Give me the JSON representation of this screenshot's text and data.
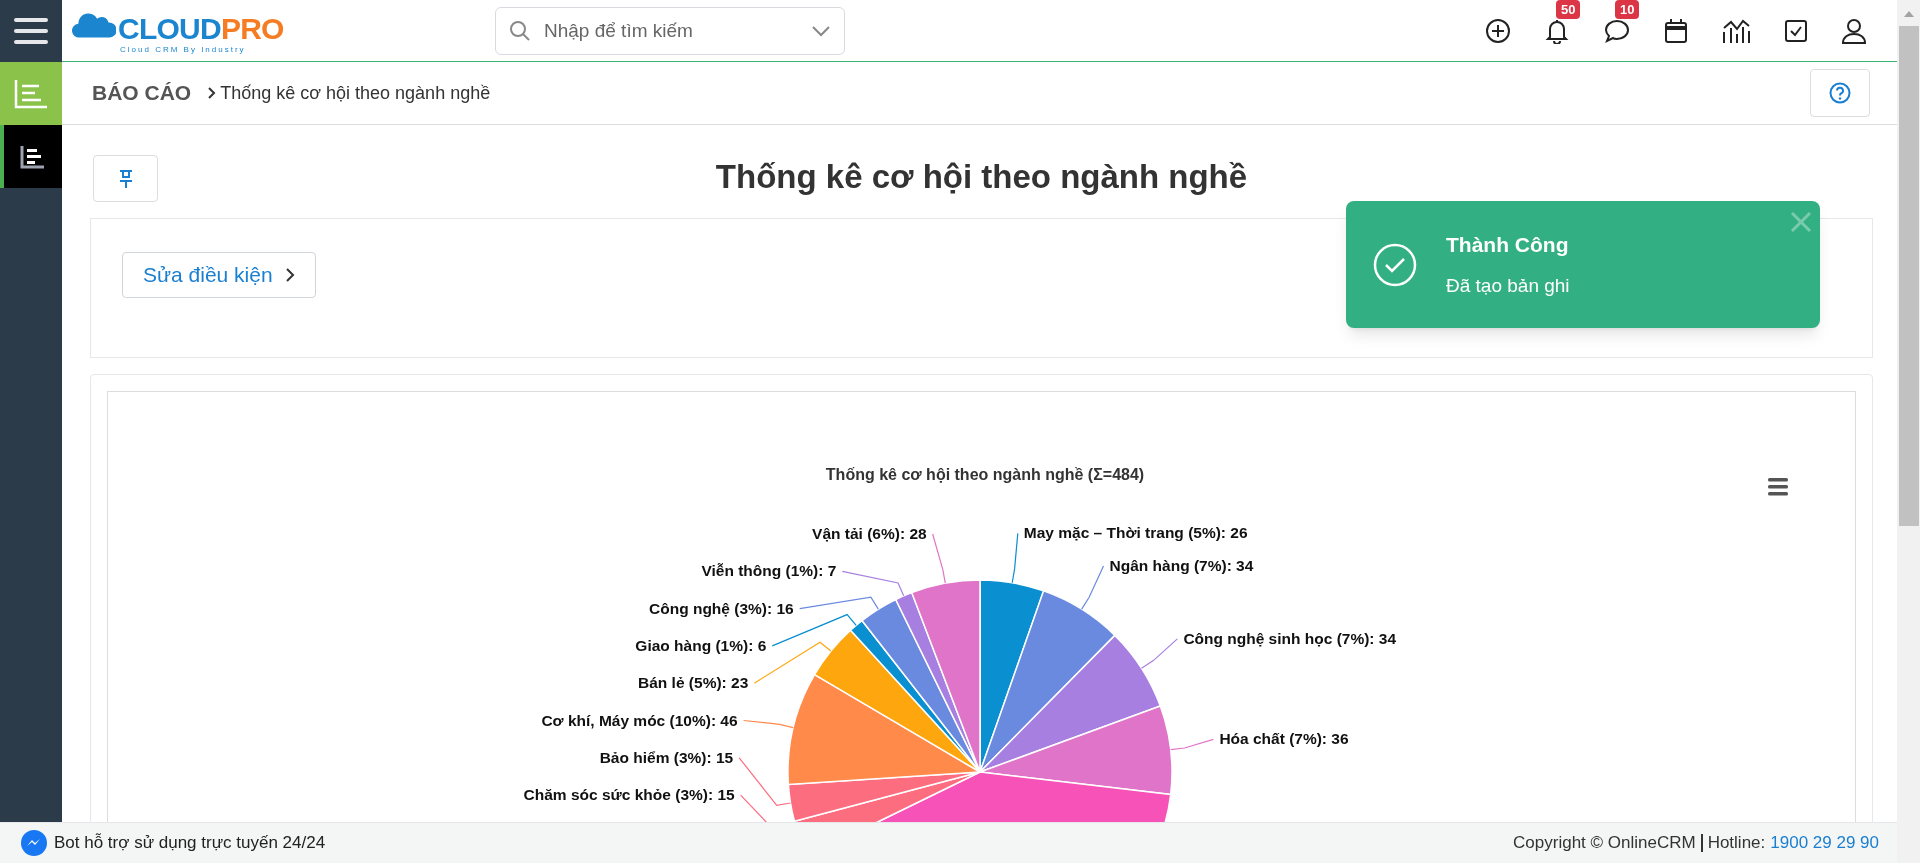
{
  "logo": {
    "first": "CLOUD",
    "second": "PRO",
    "tagline": "Cloud CRM By Industry"
  },
  "header": {
    "search": {
      "placeholder": "Nhập để tìm kiếm"
    },
    "notifications": {
      "badge": "50"
    },
    "messages": {
      "badge": "10"
    }
  },
  "breadcrumb": {
    "root": "BÁO CÁO",
    "current": "Thống kê cơ hội theo ngành nghề"
  },
  "page_title": "Thống kê cơ hội theo ngành nghề",
  "filter_button": "Sửa điều kiện",
  "chart": {
    "chart_data": {
      "type": "pie",
      "title": "Thống kê cơ hội theo ngành nghề (Σ=484)",
      "categories": [
        "May mặc – Thời trang (5%): 26",
        "Ngân hàng (7%): 34",
        "Công nghệ sinh học (7%): 34",
        "Hóa chất (7%): 36",
        null,
        "Chăm sóc sức khỏe (3%): 15",
        "Bảo hiểm (3%): 15",
        "Cơ khí, Máy móc (10%): 46",
        "Bán lẻ (5%): 23",
        "Giao hàng (1%): 6",
        "Công nghệ (3%): 16",
        "Viễn thông (1%): 7",
        "Vận tải (6%): 28"
      ],
      "values": [
        26,
        34,
        34,
        36,
        198,
        15,
        15,
        46,
        23,
        6,
        16,
        7,
        28
      ],
      "colors": [
        "#0a8fd0",
        "#6a8ae0",
        "#a77fe0",
        "#e074c8",
        "#f752b8",
        "#fd6d80",
        "#fd6d80",
        "#ff8a4a",
        "#fda60d",
        "#0a8fd0",
        "#6a8ae0",
        "#a77fe0",
        "#e074c8"
      ]
    }
  },
  "toast": {
    "title": "Thành Công",
    "message": "Đã tạo bản ghi"
  },
  "footer": {
    "bot_text": "Bot hỗ trợ sử dụng trực tuyến 24/24",
    "copyright": "Copyright © OnlineCRM",
    "hotline_label": "Hotline:",
    "hotline": "1900 29 29 90"
  }
}
